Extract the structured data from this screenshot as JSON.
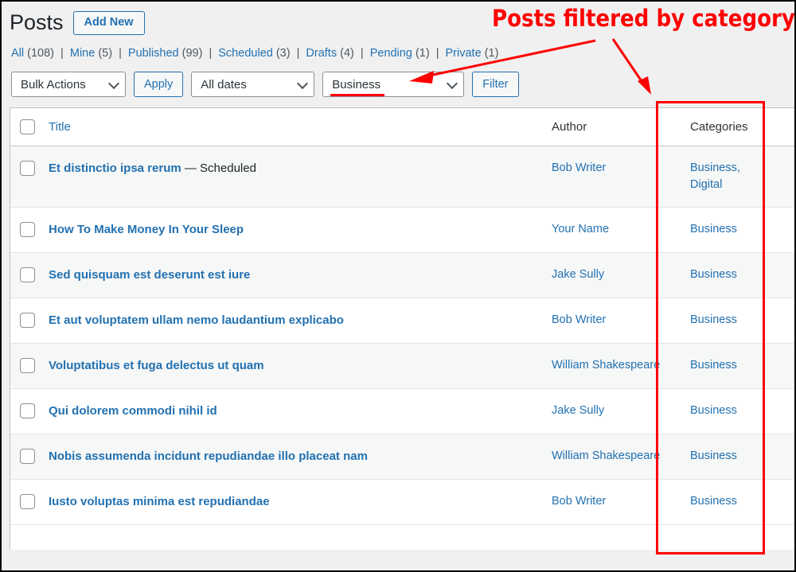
{
  "header": {
    "page_title": "Posts",
    "add_new_label": "Add New"
  },
  "views": [
    {
      "label": "All",
      "count": "(108)"
    },
    {
      "label": "Mine",
      "count": "(5)"
    },
    {
      "label": "Published",
      "count": "(99)"
    },
    {
      "label": "Scheduled",
      "count": "(3)"
    },
    {
      "label": "Drafts",
      "count": "(4)"
    },
    {
      "label": "Pending",
      "count": "(1)"
    },
    {
      "label": "Private",
      "count": "(1)"
    }
  ],
  "view_separator": "|",
  "toolbar": {
    "bulk_actions_value": "Bulk Actions",
    "apply_label": "Apply",
    "dates_value": "All dates",
    "category_value": "Business",
    "filter_label": "Filter"
  },
  "table": {
    "columns": {
      "checkbox": "",
      "title": "Title",
      "author": "Author",
      "categories": "Categories"
    },
    "rows": [
      {
        "title": "Et distinctio ipsa rerum",
        "state": " — Scheduled",
        "author": "Bob Writer",
        "categories": "Business, Digital"
      },
      {
        "title": "How To Make Money In Your Sleep",
        "state": "",
        "author": "Your Name",
        "categories": "Business"
      },
      {
        "title": "Sed quisquam est deserunt est iure",
        "state": "",
        "author": "Jake Sully",
        "categories": "Business"
      },
      {
        "title": "Et aut voluptatem ullam nemo laudantium explicabo",
        "state": "",
        "author": "Bob Writer",
        "categories": "Business"
      },
      {
        "title": "Voluptatibus et fuga delectus ut quam",
        "state": "",
        "author": "William Shakespeare",
        "categories": "Business"
      },
      {
        "title": "Qui dolorem commodi nihil id",
        "state": "",
        "author": "Jake Sully",
        "categories": "Business"
      },
      {
        "title": "Nobis assumenda incidunt repudiandae illo placeat nam",
        "state": "",
        "author": "William Shakespeare",
        "categories": "Business"
      },
      {
        "title": "Iusto voluptas minima est repudiandae",
        "state": "",
        "author": "Bob Writer",
        "categories": "Business"
      }
    ]
  },
  "annotation": {
    "text": "Posts filtered by category",
    "color": "#ff0000"
  },
  "colors": {
    "link": "#2271b1",
    "text": "#1d2327",
    "muted": "#50575e",
    "page_bg": "#f0f0f1",
    "row_alt_bg": "#f6f7f7",
    "border": "#c3c4c7",
    "annotation": "#ff0000"
  }
}
